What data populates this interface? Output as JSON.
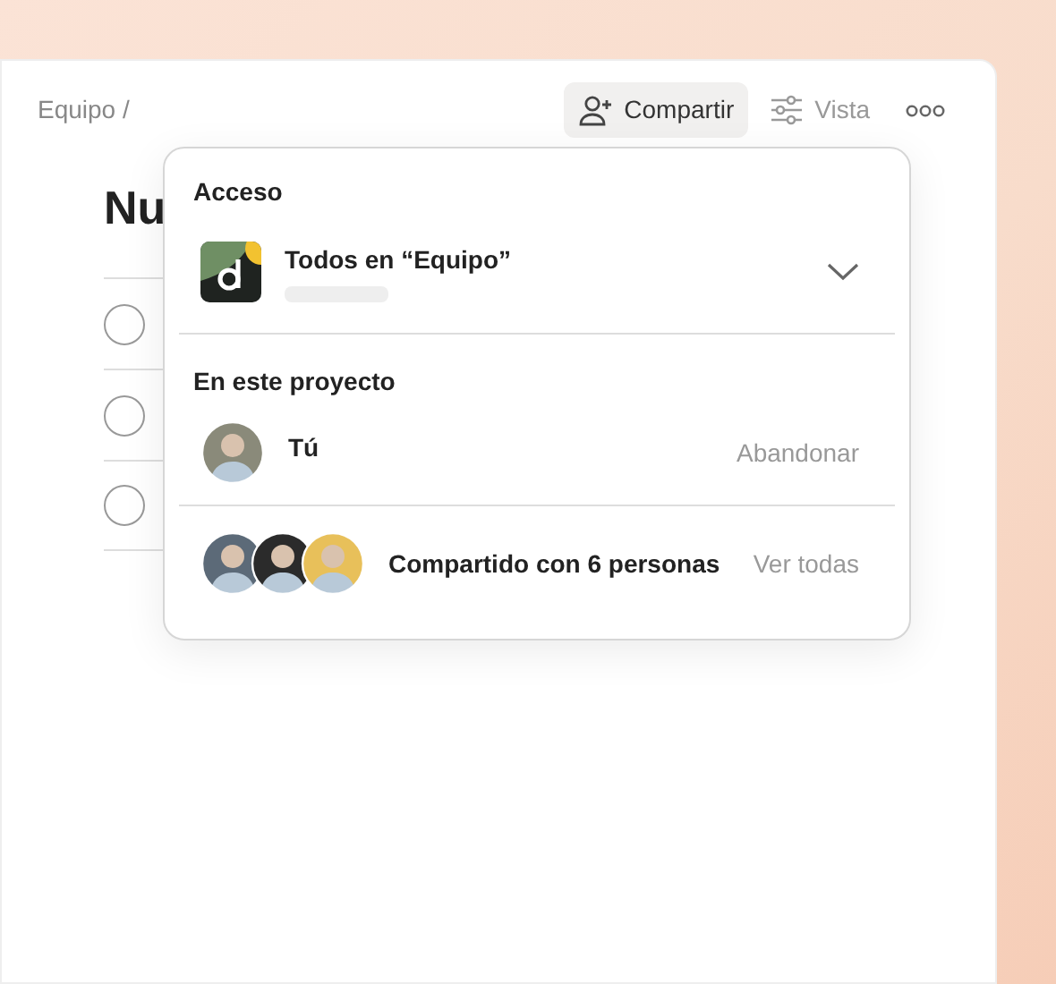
{
  "breadcrumb": "Equipo /",
  "toolbar": [
    {
      "kind": "share",
      "label": "Compartir",
      "selected": true
    },
    {
      "kind": "view",
      "label": "Vista",
      "selected": false
    },
    {
      "kind": "more",
      "selected": false
    }
  ],
  "page_title": "Nu",
  "tasks": [
    {
      "checked": false
    },
    {
      "checked": false
    },
    {
      "checked": false
    }
  ],
  "popover": {
    "access_title": "Acceso",
    "access_option": {
      "label": "Todos en “Equipo”"
    },
    "members_title": "En este proyecto",
    "members": [
      {
        "kind": "self",
        "name": "Tú",
        "action": "Abandonar"
      },
      {
        "kind": "group",
        "name": "Compartido con 6 personas",
        "action": "Ver todas"
      }
    ]
  }
}
